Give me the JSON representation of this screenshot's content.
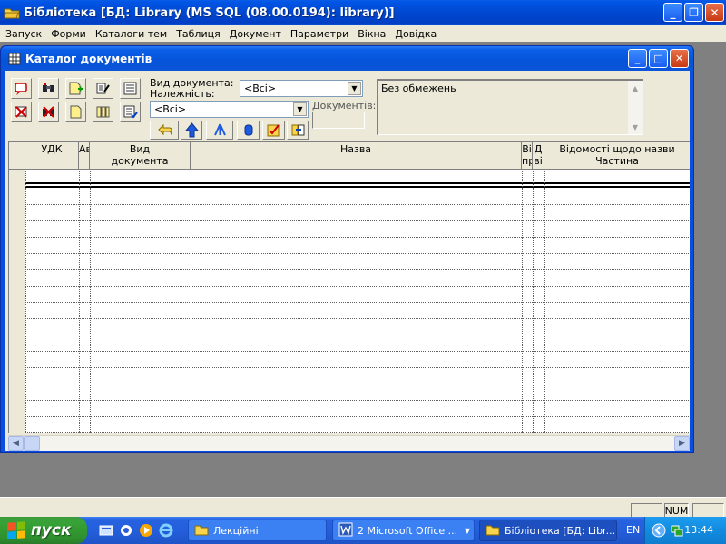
{
  "app": {
    "title": "Бібліотека [БД: Library (MS SQL (08.00.0194): library)]",
    "window_buttons": [
      "minimize",
      "restore",
      "close"
    ]
  },
  "menu": [
    "Запуск",
    "Форми",
    "Каталоги тем",
    "Таблиця",
    "Документ",
    "Параметри",
    "Вікна",
    "Довідка"
  ],
  "child_window": {
    "title": "Каталог документів",
    "window_buttons": [
      "minimize",
      "maximize",
      "close"
    ]
  },
  "toolbar": {
    "doc_type_label": "Вид документа:",
    "doc_type_value": "<Всі>",
    "belonging_label": "Належність:",
    "belonging_value": "<Всі>",
    "documents_label": "Документів:",
    "documents_count": "",
    "filter_text": "Без обмежень",
    "icons_left": [
      "add-record-icon",
      "find-icon",
      "add-doc-icon",
      "book-edit-icon",
      "list-icon",
      "delete-icon",
      "delete-find-icon",
      "document-icon",
      "books-icon",
      "list-check-icon"
    ],
    "nav_icons": [
      "undo-arrow-icon",
      "up-arrow-icon",
      "tree-icon",
      "cylinder-icon",
      "check-doc-icon",
      "export-icon"
    ]
  },
  "grid": {
    "columns": [
      {
        "label": "",
        "sub": ""
      },
      {
        "label": "УДК",
        "sub": ""
      },
      {
        "label": "Ав",
        "sub": ""
      },
      {
        "label": "Вид",
        "sub": "документа"
      },
      {
        "label": "Назва",
        "sub": ""
      },
      {
        "label": "Ві",
        "sub": "пр"
      },
      {
        "label": "Д",
        "sub": "ві"
      },
      {
        "label": "Відомості щодо назви",
        "sub": "Частина"
      }
    ],
    "row_count": 16
  },
  "statusbar": {
    "panels": [
      "",
      "NUM",
      ""
    ]
  },
  "taskbar": {
    "start_label": "пуск",
    "tasks": [
      "Лекційні",
      "2 Microsoft Office ...",
      "Бібліотека [БД: Libr..."
    ],
    "lang": "EN",
    "clock": "13:44"
  },
  "colors": {
    "titlebar": "#0054e3",
    "chrome": "#ece9d8",
    "taskbar": "#245edb",
    "start": "#37a337"
  }
}
